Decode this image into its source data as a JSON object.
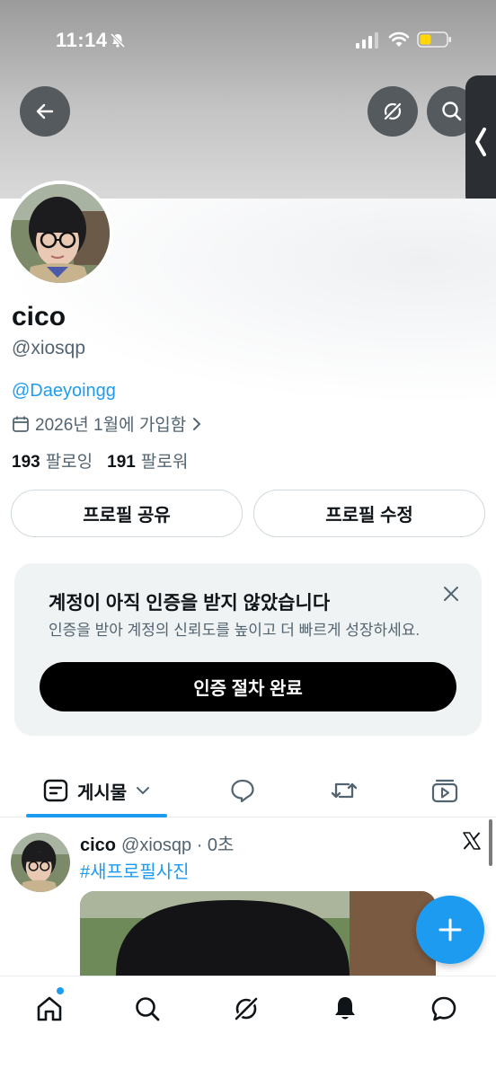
{
  "status_bar": {
    "time": "11:14"
  },
  "profile": {
    "name": "cico",
    "handle": "@xiosqp",
    "bio_mention": "@Daeyoingg",
    "joined": "2026년 1월에 가입함",
    "following_count": "193",
    "following_label": "팔로잉",
    "followers_count": "191",
    "followers_label": "팔로워"
  },
  "actions": {
    "share_label": "프로필 공유",
    "edit_label": "프로필 수정"
  },
  "verify": {
    "title": "계정이 아직 인증을 받지 않았습니다",
    "subtitle": "인증을 받아 계정의 신뢰도를 높이고 더 빠르게 성장하세요.",
    "button_label": "인증 절차 완료"
  },
  "tabs": {
    "posts_label": "게시물"
  },
  "post": {
    "name": "cico",
    "meta": "@xiosqp · 0초",
    "hashtag": "#새프로필사진"
  },
  "colors": {
    "accent": "#1d9bf0",
    "text_primary": "#0f1419",
    "text_secondary": "#536471"
  },
  "icons": {
    "back": "arrow-left-icon",
    "grok": "grok-icon",
    "search": "search-icon",
    "calendar": "calendar-icon",
    "close": "close-icon",
    "compose": "plus-icon"
  }
}
